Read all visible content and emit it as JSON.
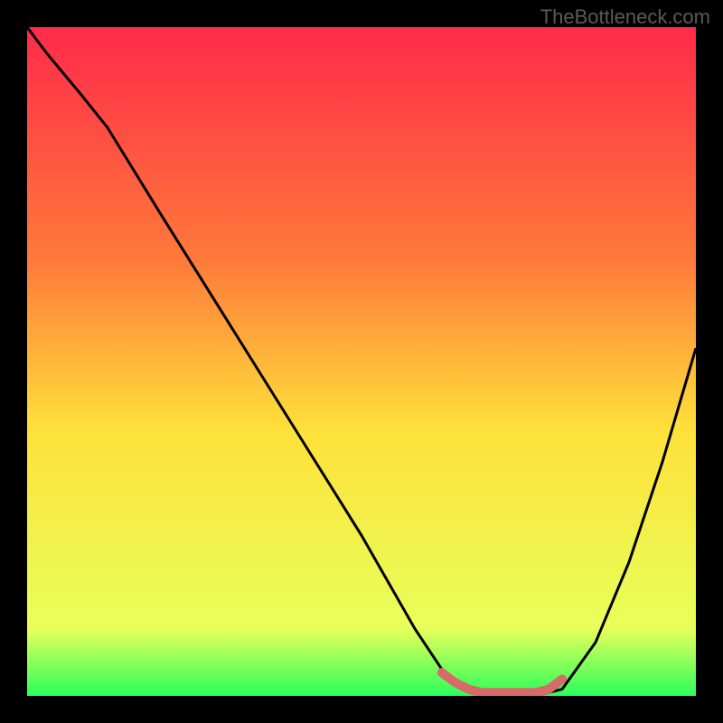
{
  "watermark": "TheBottleneck.com",
  "chart_data": {
    "type": "line",
    "title": "",
    "xlabel": "",
    "ylabel": "",
    "xlim": [
      0,
      100
    ],
    "ylim": [
      0,
      100
    ],
    "gradient_stops": [
      {
        "offset": 0,
        "color": "#ff2a4a"
      },
      {
        "offset": 35,
        "color": "#ff7a3a"
      },
      {
        "offset": 60,
        "color": "#ffe03a"
      },
      {
        "offset": 90,
        "color": "#e8ff5a"
      },
      {
        "offset": 100,
        "color": "#2aff5a"
      }
    ],
    "series": [
      {
        "name": "bottleneck-curve",
        "color": "#000000",
        "points": [
          {
            "x": 0,
            "y": 100
          },
          {
            "x": 3,
            "y": 96
          },
          {
            "x": 8,
            "y": 90
          },
          {
            "x": 12,
            "y": 85
          },
          {
            "x": 20,
            "y": 72
          },
          {
            "x": 30,
            "y": 56
          },
          {
            "x": 40,
            "y": 40
          },
          {
            "x": 50,
            "y": 24
          },
          {
            "x": 58,
            "y": 10
          },
          {
            "x": 62,
            "y": 4
          },
          {
            "x": 65,
            "y": 1
          },
          {
            "x": 68,
            "y": 0
          },
          {
            "x": 72,
            "y": 0
          },
          {
            "x": 76,
            "y": 0
          },
          {
            "x": 80,
            "y": 1
          },
          {
            "x": 85,
            "y": 8
          },
          {
            "x": 90,
            "y": 20
          },
          {
            "x": 95,
            "y": 35
          },
          {
            "x": 100,
            "y": 52
          }
        ]
      },
      {
        "name": "optimal-band",
        "color": "#d86a6a",
        "points": [
          {
            "x": 62,
            "y": 3.5
          },
          {
            "x": 64,
            "y": 2
          },
          {
            "x": 66,
            "y": 1
          },
          {
            "x": 68,
            "y": 0.5
          },
          {
            "x": 70,
            "y": 0.5
          },
          {
            "x": 72,
            "y": 0.5
          },
          {
            "x": 74,
            "y": 0.5
          },
          {
            "x": 76,
            "y": 0.5
          },
          {
            "x": 78,
            "y": 1
          },
          {
            "x": 80,
            "y": 2.5
          }
        ]
      }
    ]
  }
}
